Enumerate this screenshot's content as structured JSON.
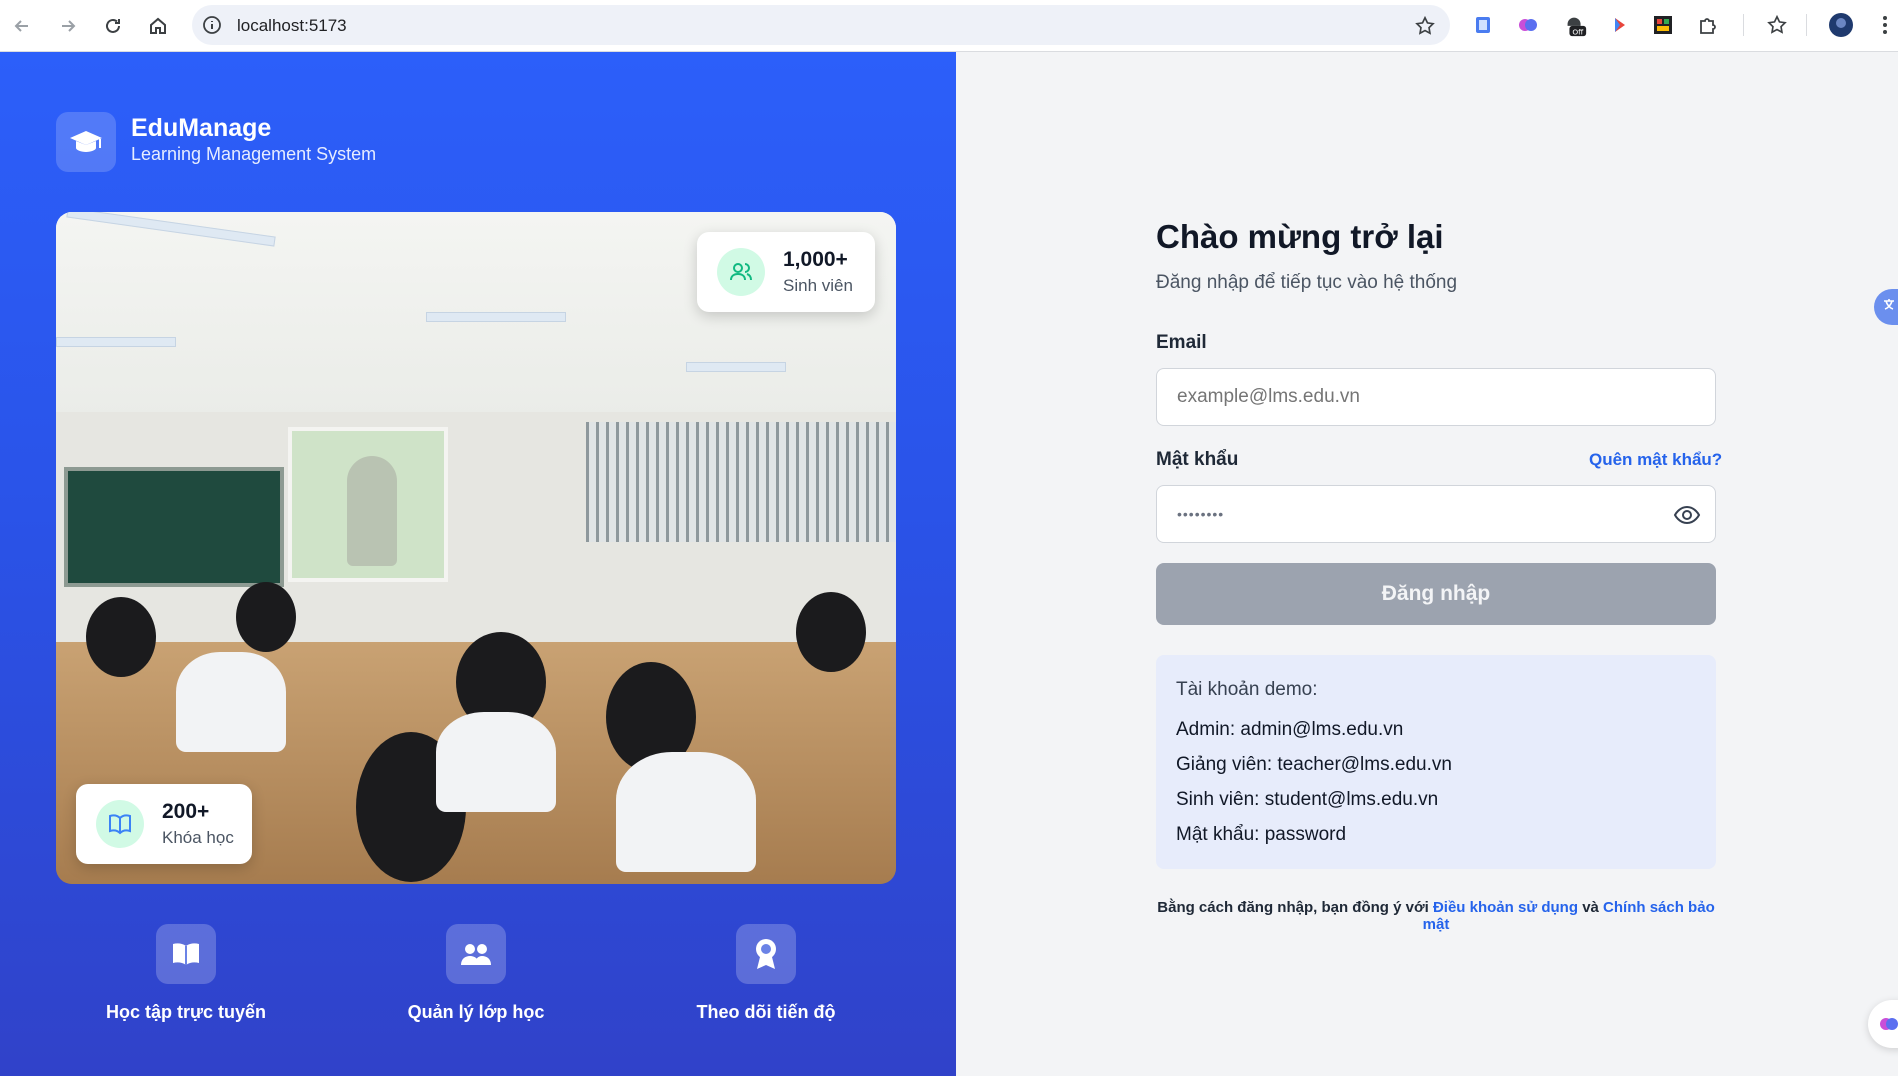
{
  "browser": {
    "url": "localhost:5173"
  },
  "brand": {
    "name": "EduManage",
    "subtitle": "Learning Management System"
  },
  "hero_stats": [
    {
      "value": "1,000+",
      "label": "Sinh viên"
    },
    {
      "value": "200+",
      "label": "Khóa học"
    }
  ],
  "features": [
    {
      "label": "Học tập trực tuyến",
      "icon": "book-open-icon"
    },
    {
      "label": "Quản lý lớp học",
      "icon": "users-icon"
    },
    {
      "label": "Theo dõi tiến độ",
      "icon": "award-icon"
    }
  ],
  "form": {
    "title": "Chào mừng trở lại",
    "subtitle": "Đăng nhập để tiếp tục vào hệ thống",
    "email_label": "Email",
    "email_placeholder": "example@lms.edu.vn",
    "password_label": "Mật khẩu",
    "password_value": "••••••••",
    "forgot_label": "Quên mật khẩu?",
    "submit_label": "Đăng nhập"
  },
  "demo": {
    "title": "Tài khoản demo:",
    "lines": [
      "Admin: admin@lms.edu.vn",
      "Giảng viên: teacher@lms.edu.vn",
      "Sinh viên: student@lms.edu.vn",
      "Mật khẩu: password"
    ]
  },
  "terms": {
    "prefix": "Bằng cách đăng nhập, bạn đồng ý với",
    "terms_link": "Điều khoản sử dụng",
    "and": "và",
    "privacy_link": "Chính sách bảo mật"
  },
  "colors": {
    "primary": "#2563eb",
    "hero_gradient_top": "#2c5ffa",
    "hero_gradient_bottom": "#3042c9",
    "button_disabled": "#9ca3af",
    "demo_bg": "#e7ecfb"
  }
}
